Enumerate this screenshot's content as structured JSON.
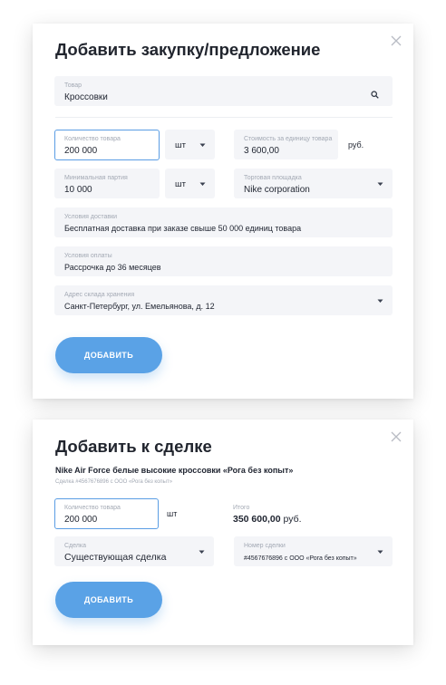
{
  "purchase_modal": {
    "title": "Добавить закупку/предложение",
    "product": {
      "label": "Товар",
      "value": "Кроссовки"
    },
    "quantity": {
      "label": "Количество товара",
      "value": "200 000",
      "unit": "шт"
    },
    "unit_price": {
      "label": "Стоимость за единицу товара",
      "value": "3 600,00",
      "currency": "руб."
    },
    "min_batch": {
      "label": "Минимальная партия",
      "value": "10 000",
      "unit": "шт"
    },
    "platform": {
      "label": "Торговая площадка",
      "value": "Nike corporation"
    },
    "delivery": {
      "label": "Условия доставки",
      "value": "Бесплатная доставка при заказе свыше 50 000 единиц товара"
    },
    "payment": {
      "label": "Условия оплаты",
      "value": "Рассрочка до 36 месяцев"
    },
    "warehouse": {
      "label": "Адрес склада хранения",
      "value": "Санкт-Петербург, ул. Емельянова, д. 12"
    },
    "submit_label": "ДОБАВИТЬ"
  },
  "deal_modal": {
    "title": "Добавить к сделке",
    "product_name": "Nike Air Force белые высокие кроссовки «Рога без копыт»",
    "deal_caption": "Сделка #4567676896 с ООО «Рога без копыт»",
    "quantity": {
      "label": "Количество товара",
      "value": "200 000",
      "unit": "шт"
    },
    "total": {
      "label": "Итого",
      "value": "350 600,00",
      "currency": "руб."
    },
    "deal": {
      "label": "Сделка",
      "value": "Существующая сделка"
    },
    "deal_number": {
      "label": "Номер сделки",
      "value": "#4567676896 с ООО «Рога без копыт»"
    },
    "submit_label": "ДОБАВИТЬ"
  },
  "colors": {
    "accent": "#5aa2e6",
    "field_bg": "#f4f5f8",
    "active_border": "#5a9de4"
  },
  "icons": {
    "close": "close-icon",
    "search": "search-icon",
    "dropdown": "chevron-down-icon"
  }
}
